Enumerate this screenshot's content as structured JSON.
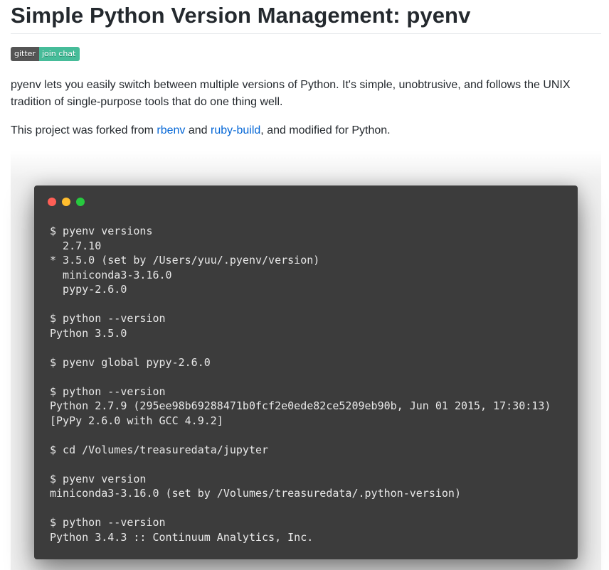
{
  "page": {
    "title": "Simple Python Version Management: pyenv"
  },
  "badge": {
    "left": "gitter",
    "right": "join chat",
    "left_color": "#555555",
    "right_color": "#46bc99"
  },
  "intro": {
    "p1": "pyenv lets you easily switch between multiple versions of Python. It's simple, unobtrusive, and follows the UNIX tradition of single-purpose tools that do one thing well.",
    "p2_before": "This project was forked from ",
    "link_rbenv": "rbenv",
    "p2_and": " and ",
    "link_ruby_build": "ruby-build",
    "p2_after": ", and modified for Python."
  },
  "terminal": {
    "window_dots": [
      {
        "name": "close",
        "color": "#ff5f56"
      },
      {
        "name": "minimize",
        "color": "#ffbd2e"
      },
      {
        "name": "maximize",
        "color": "#27c93f"
      }
    ],
    "lines": [
      "$ pyenv versions",
      "  2.7.10",
      "* 3.5.0 (set by /Users/yuu/.pyenv/version)",
      "  miniconda3-3.16.0",
      "  pypy-2.6.0",
      "",
      "$ python --version",
      "Python 3.5.0",
      "",
      "$ pyenv global pypy-2.6.0",
      "",
      "$ python --version",
      "Python 2.7.9 (295ee98b69288471b0fcf2e0ede82ce5209eb90b, Jun 01 2015, 17:30:13)",
      "[PyPy 2.6.0 with GCC 4.9.2]",
      "",
      "$ cd /Volumes/treasuredata/jupyter",
      "",
      "$ pyenv version",
      "miniconda3-3.16.0 (set by /Volumes/treasuredata/.python-version)",
      "",
      "$ python --version",
      "Python 3.4.3 :: Continuum Analytics, Inc."
    ]
  }
}
